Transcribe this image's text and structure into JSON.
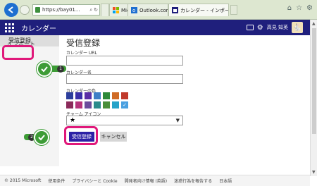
{
  "browser": {
    "url": "https://bay01...",
    "tabs": [
      {
        "label": "Micr..."
      },
      {
        "label": "Outlook.com - takamichie..."
      },
      {
        "label": "カレンダー - インポートまたは..."
      }
    ]
  },
  "app": {
    "title": "カレンダー",
    "user_name": "高見 知英"
  },
  "sidebar": {
    "items": [
      {
        "label": "インポート"
      },
      {
        "label": "受信登録"
      }
    ]
  },
  "form": {
    "heading": "受信登録",
    "url_label": "カレンダー URL",
    "url_value": "",
    "name_label": "カレンダー名",
    "name_value": "",
    "color_label": "カレンダーの色",
    "colors": [
      "#2c3e9c",
      "#3a2fa8",
      "#5a2ea6",
      "#3e7fc6",
      "#2e8a3a",
      "#d06b25",
      "#c0392b",
      "#8b2a5a",
      "#b5337a",
      "#6b4c9a",
      "#2a8b8b",
      "#4a8f3a",
      "#26a3c9",
      "#4aa0e0"
    ],
    "selected_color_index": 13,
    "icon_label": "チャーム アイコン",
    "icon_value": "★",
    "submit_label": "受信登録",
    "cancel_label": "キャンセル"
  },
  "annotations": {
    "step1": "1",
    "step2": "2"
  },
  "footer": {
    "copyright": "© 2015 Microsoft",
    "links": [
      "使用条件",
      "プライバシーと Cookie",
      "開発者向け情報 (英語)",
      "迷惑行為を報告する",
      "日本語"
    ]
  }
}
